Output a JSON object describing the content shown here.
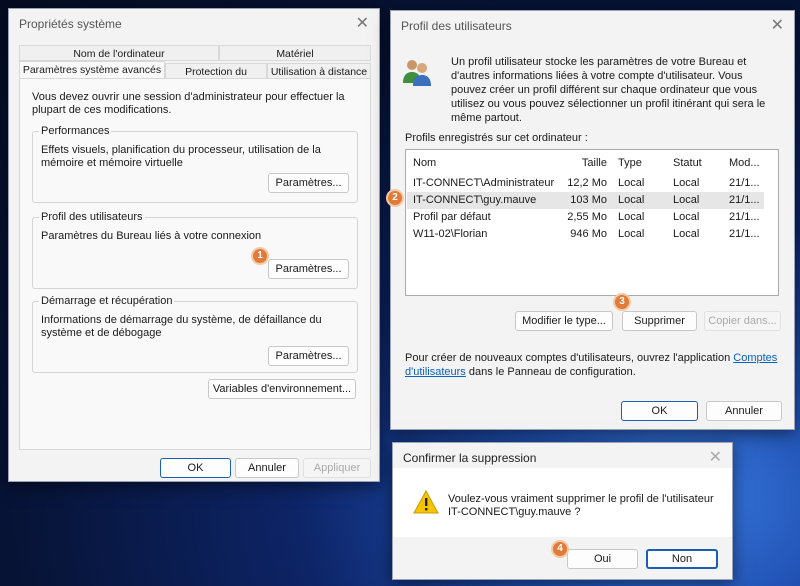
{
  "sys": {
    "title": "Propriétés système",
    "tabs_row1": [
      "Nom de l'ordinateur",
      "Matériel"
    ],
    "tabs_row2": [
      "Paramètres système avancés",
      "Protection du système",
      "Utilisation à distance"
    ],
    "intro": "Vous devez ouvrir une session d'administrateur pour effectuer la plupart de ces modifications.",
    "groups": [
      {
        "label": "Performances",
        "desc": "Effets visuels, planification du processeur, utilisation de la mémoire et mémoire virtuelle",
        "button": "Paramètres..."
      },
      {
        "label": "Profil des utilisateurs",
        "desc": "Paramètres du Bureau liés à votre connexion",
        "button": "Paramètres..."
      },
      {
        "label": "Démarrage et récupération",
        "desc": "Informations de démarrage du système, de défaillance du système et de débogage",
        "button": "Paramètres..."
      }
    ],
    "env_button": "Variables d'environnement...",
    "ok": "OK",
    "cancel": "Annuler",
    "apply": "Appliquer"
  },
  "profiles": {
    "title": "Profil des utilisateurs",
    "desc": "Un profil utilisateur stocke les paramètres de votre Bureau et d'autres informations liées à votre compte d'utilisateur. Vous pouvez créer un profil différent sur chaque ordinateur que vous utilisez ou vous pouvez sélectionner un profil itinérant qui sera le même partout.",
    "list_label": "Profils enregistrés sur cet ordinateur :",
    "columns": [
      "Nom",
      "Taille",
      "Type",
      "Statut",
      "Mod..."
    ],
    "rows": [
      [
        "IT-CONNECT\\Administrateur",
        "12,2 Mo",
        "Local",
        "Local",
        "21/1..."
      ],
      [
        "IT-CONNECT\\guy.mauve",
        "103 Mo",
        "Local",
        "Local",
        "21/1..."
      ],
      [
        "Profil par défaut",
        "2,55 Mo",
        "Local",
        "Local",
        "21/1..."
      ],
      [
        "W11-02\\Florian",
        "946 Mo",
        "Local",
        "Local",
        "21/1..."
      ]
    ],
    "change_type": "Modifier le type...",
    "delete": "Supprimer",
    "copy": "Copier dans...",
    "footer_pre": "Pour créer de nouveaux comptes d'utilisateurs, ouvrez l'application ",
    "footer_link": "Comptes d'utilisateurs",
    "footer_post": " dans le Panneau de configuration.",
    "ok": "OK",
    "cancel": "Annuler"
  },
  "confirm": {
    "title": "Confirmer la suppression",
    "message1": "Voulez-vous vraiment supprimer le profil de l'utilisateur",
    "message2": "IT-CONNECT\\guy.mauve ?",
    "yes": "Oui",
    "no": "Non"
  },
  "badges": [
    "1",
    "2",
    "3",
    "4"
  ]
}
